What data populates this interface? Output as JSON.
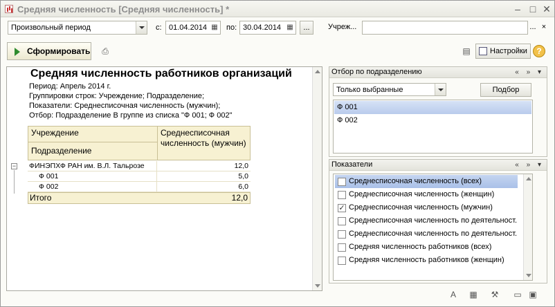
{
  "window": {
    "title": "Средняя численность [Средняя численность] *",
    "minimize_icon": "minimize-icon",
    "maximize_icon": "maximize-icon",
    "close_icon": "close-icon"
  },
  "period": {
    "mode_value": "Произвольный период",
    "from_label": "с:",
    "from_value": "01.04.2014",
    "to_label": "по:",
    "to_value": "30.04.2014",
    "more_label": "...",
    "org_label": "Учреж...",
    "org_value": "",
    "org_more": "...",
    "org_clear": "×"
  },
  "toolbar": {
    "run_label": "Сформировать",
    "settings_label": "Настройки",
    "help_label": "?"
  },
  "report": {
    "title": "Средняя численность работников организаций",
    "period_line": "Период: Апрель 2014 г.",
    "grouping_line": "Группировки строк: Учреждение; Подразделение;",
    "indicators_line": "Показатели: Среднесписочная численность (мужчин);",
    "filter_line": "Отбор: Подразделение В группе из списка \"Ф 001; Ф 002\"",
    "col_institution": "Учреждение",
    "col_subdivision": "Подразделение",
    "col_value": "Среднесписочная численность (мужчин)",
    "rows": [
      {
        "name": "ФИНЭПХФ РАН им. В.Л. Тальрозе",
        "value": "12,0"
      },
      {
        "name": "Ф 001",
        "value": "5,0"
      },
      {
        "name": "Ф 002",
        "value": "6,0"
      }
    ],
    "total_label": "Итого",
    "total_value": "12,0"
  },
  "filter_panel": {
    "title": "Отбор по подразделению",
    "mode_value": "Только выбранные",
    "pick_label": "Подбор",
    "items": [
      "Ф 001",
      "Ф 002"
    ]
  },
  "indicators_panel": {
    "title": "Показатели",
    "items": [
      {
        "label": "Среднесписочная численность (всех)",
        "checked": false
      },
      {
        "label": "Среднесписочная численность (женщин)",
        "checked": false
      },
      {
        "label": "Среднесписочная численность (мужчин)",
        "checked": true
      },
      {
        "label": "Среднесписочная численность по деятельност...",
        "checked": false
      },
      {
        "label": "Среднесписочная численность по деятельност...",
        "checked": false
      },
      {
        "label": "Средняя численность работников (всех)",
        "checked": false
      },
      {
        "label": "Средняя численность работников (женщин)",
        "checked": false
      }
    ]
  },
  "panel_controls": "« » ▾"
}
